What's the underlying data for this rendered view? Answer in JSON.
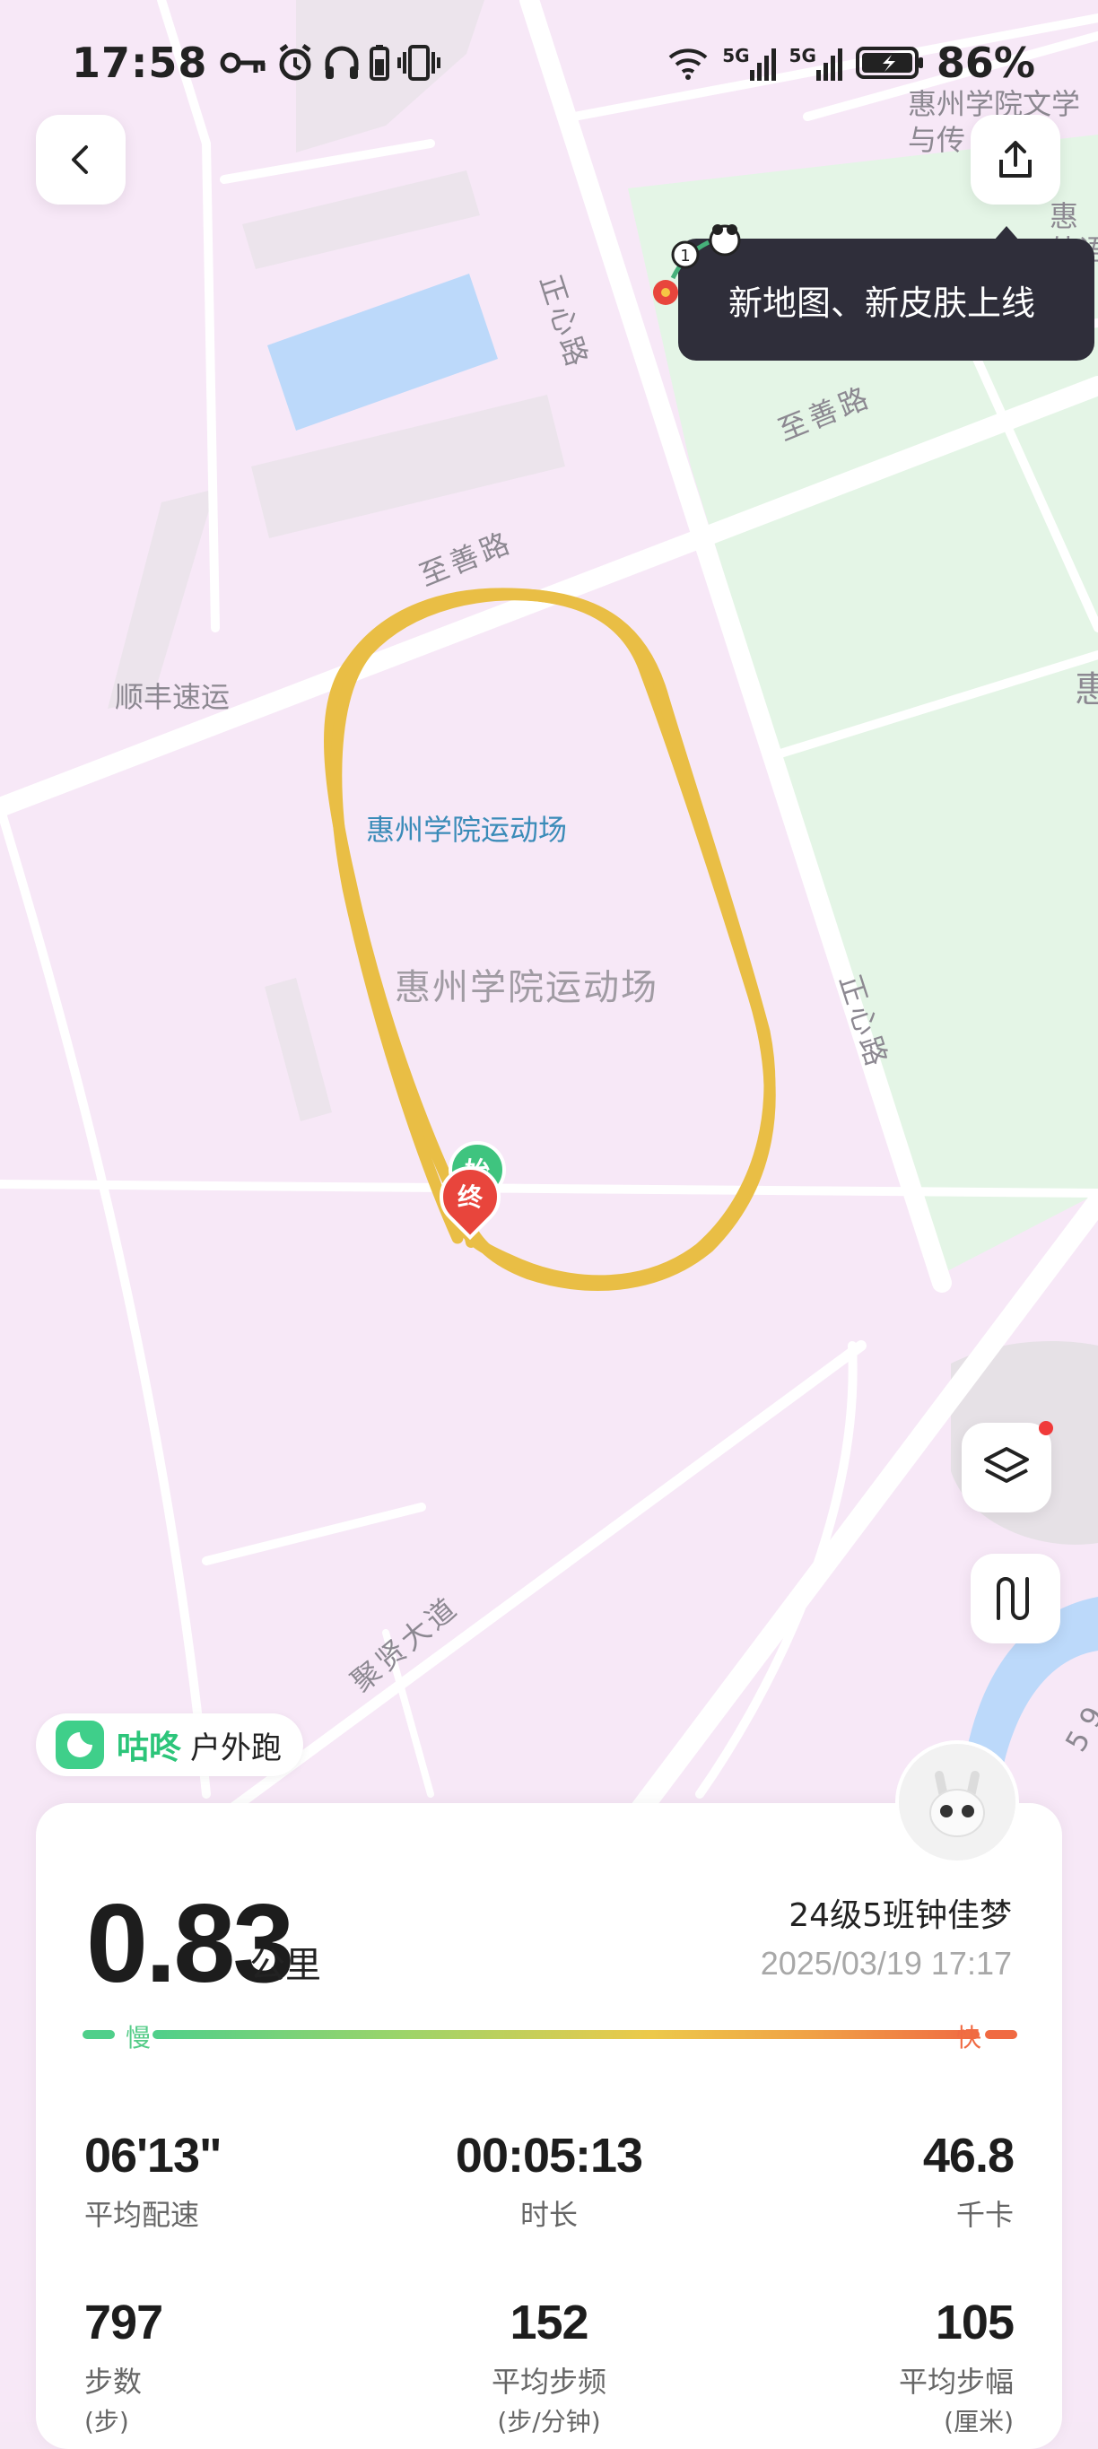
{
  "status_bar": {
    "time": "17:58",
    "battery": "86%",
    "network_1": "5G",
    "network_2": "5G",
    "icons": [
      "key-icon",
      "alarm-icon",
      "headphones-icon",
      "battery-small-icon",
      "vibrate-icon",
      "wifi-icon",
      "signal-icon",
      "charging-battery-icon"
    ]
  },
  "header": {
    "back_icon": "chevron-left-icon",
    "share_icon": "share-icon"
  },
  "tooltip": {
    "text": "新地图、新皮肤上线"
  },
  "map": {
    "poi_top_right_1": "惠州学院文学",
    "poi_top_right_2": "与传",
    "poi_right_1": "惠",
    "poi_right_2": "外语",
    "poi_right_3": "惠",
    "road_zhengxin_top": "正心路",
    "road_zhishan_right": "至善路",
    "road_zhishan_left": "至善路",
    "poi_shunfeng": "顺丰速运",
    "track_label_blue": "惠州学院运动场",
    "track_label_gray": "惠州学院运动场",
    "road_zhengxin_mid": "正心路",
    "road_juxian": "聚贤大道",
    "road_bottom_right": "5 9",
    "start_marker": "始",
    "end_marker": "终",
    "track_color": "#e9be45"
  },
  "controls": {
    "layers_icon": "layers-icon",
    "route_icon": "route-icon"
  },
  "brand": {
    "name": "咕咚",
    "type": "户外跑"
  },
  "summary": {
    "distance": "0.83",
    "distance_unit": "公里",
    "user": "24级5班钟佳梦",
    "datetime": "2025/03/19 17:17",
    "slow_label": "慢",
    "fast_label": "快"
  },
  "stats": [
    {
      "value": "06'13\"",
      "label": "平均配速"
    },
    {
      "value": "00:05:13",
      "label": "时长"
    },
    {
      "value": "46.8",
      "label": "千卡"
    },
    {
      "value": "797",
      "label": "步数",
      "sub": "(步)"
    },
    {
      "value": "152",
      "label": "平均步频",
      "sub": "(步/分钟)"
    },
    {
      "value": "105",
      "label": "平均步幅",
      "sub": "(厘米)"
    }
  ]
}
